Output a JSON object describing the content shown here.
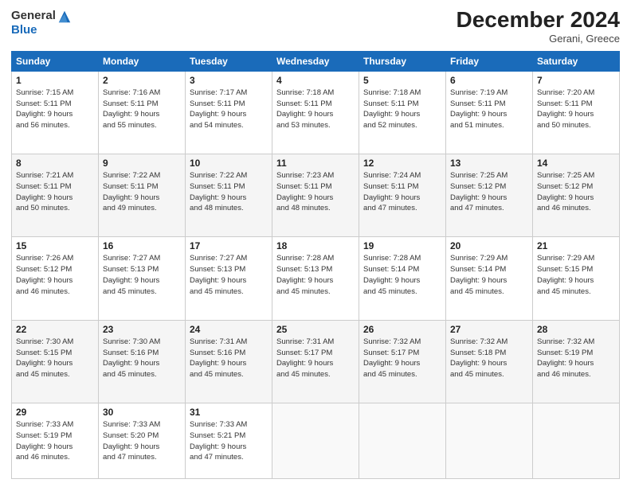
{
  "header": {
    "logo_general": "General",
    "logo_blue": "Blue",
    "month_title": "December 2024",
    "subtitle": "Gerani, Greece"
  },
  "weekdays": [
    "Sunday",
    "Monday",
    "Tuesday",
    "Wednesday",
    "Thursday",
    "Friday",
    "Saturday"
  ],
  "weeks": [
    [
      {
        "day": "1",
        "info": "Sunrise: 7:15 AM\nSunset: 5:11 PM\nDaylight: 9 hours\nand 56 minutes."
      },
      {
        "day": "2",
        "info": "Sunrise: 7:16 AM\nSunset: 5:11 PM\nDaylight: 9 hours\nand 55 minutes."
      },
      {
        "day": "3",
        "info": "Sunrise: 7:17 AM\nSunset: 5:11 PM\nDaylight: 9 hours\nand 54 minutes."
      },
      {
        "day": "4",
        "info": "Sunrise: 7:18 AM\nSunset: 5:11 PM\nDaylight: 9 hours\nand 53 minutes."
      },
      {
        "day": "5",
        "info": "Sunrise: 7:18 AM\nSunset: 5:11 PM\nDaylight: 9 hours\nand 52 minutes."
      },
      {
        "day": "6",
        "info": "Sunrise: 7:19 AM\nSunset: 5:11 PM\nDaylight: 9 hours\nand 51 minutes."
      },
      {
        "day": "7",
        "info": "Sunrise: 7:20 AM\nSunset: 5:11 PM\nDaylight: 9 hours\nand 50 minutes."
      }
    ],
    [
      {
        "day": "8",
        "info": "Sunrise: 7:21 AM\nSunset: 5:11 PM\nDaylight: 9 hours\nand 50 minutes."
      },
      {
        "day": "9",
        "info": "Sunrise: 7:22 AM\nSunset: 5:11 PM\nDaylight: 9 hours\nand 49 minutes."
      },
      {
        "day": "10",
        "info": "Sunrise: 7:22 AM\nSunset: 5:11 PM\nDaylight: 9 hours\nand 48 minutes."
      },
      {
        "day": "11",
        "info": "Sunrise: 7:23 AM\nSunset: 5:11 PM\nDaylight: 9 hours\nand 48 minutes."
      },
      {
        "day": "12",
        "info": "Sunrise: 7:24 AM\nSunset: 5:11 PM\nDaylight: 9 hours\nand 47 minutes."
      },
      {
        "day": "13",
        "info": "Sunrise: 7:25 AM\nSunset: 5:12 PM\nDaylight: 9 hours\nand 47 minutes."
      },
      {
        "day": "14",
        "info": "Sunrise: 7:25 AM\nSunset: 5:12 PM\nDaylight: 9 hours\nand 46 minutes."
      }
    ],
    [
      {
        "day": "15",
        "info": "Sunrise: 7:26 AM\nSunset: 5:12 PM\nDaylight: 9 hours\nand 46 minutes."
      },
      {
        "day": "16",
        "info": "Sunrise: 7:27 AM\nSunset: 5:13 PM\nDaylight: 9 hours\nand 45 minutes."
      },
      {
        "day": "17",
        "info": "Sunrise: 7:27 AM\nSunset: 5:13 PM\nDaylight: 9 hours\nand 45 minutes."
      },
      {
        "day": "18",
        "info": "Sunrise: 7:28 AM\nSunset: 5:13 PM\nDaylight: 9 hours\nand 45 minutes."
      },
      {
        "day": "19",
        "info": "Sunrise: 7:28 AM\nSunset: 5:14 PM\nDaylight: 9 hours\nand 45 minutes."
      },
      {
        "day": "20",
        "info": "Sunrise: 7:29 AM\nSunset: 5:14 PM\nDaylight: 9 hours\nand 45 minutes."
      },
      {
        "day": "21",
        "info": "Sunrise: 7:29 AM\nSunset: 5:15 PM\nDaylight: 9 hours\nand 45 minutes."
      }
    ],
    [
      {
        "day": "22",
        "info": "Sunrise: 7:30 AM\nSunset: 5:15 PM\nDaylight: 9 hours\nand 45 minutes."
      },
      {
        "day": "23",
        "info": "Sunrise: 7:30 AM\nSunset: 5:16 PM\nDaylight: 9 hours\nand 45 minutes."
      },
      {
        "day": "24",
        "info": "Sunrise: 7:31 AM\nSunset: 5:16 PM\nDaylight: 9 hours\nand 45 minutes."
      },
      {
        "day": "25",
        "info": "Sunrise: 7:31 AM\nSunset: 5:17 PM\nDaylight: 9 hours\nand 45 minutes."
      },
      {
        "day": "26",
        "info": "Sunrise: 7:32 AM\nSunset: 5:17 PM\nDaylight: 9 hours\nand 45 minutes."
      },
      {
        "day": "27",
        "info": "Sunrise: 7:32 AM\nSunset: 5:18 PM\nDaylight: 9 hours\nand 45 minutes."
      },
      {
        "day": "28",
        "info": "Sunrise: 7:32 AM\nSunset: 5:19 PM\nDaylight: 9 hours\nand 46 minutes."
      }
    ],
    [
      {
        "day": "29",
        "info": "Sunrise: 7:33 AM\nSunset: 5:19 PM\nDaylight: 9 hours\nand 46 minutes."
      },
      {
        "day": "30",
        "info": "Sunrise: 7:33 AM\nSunset: 5:20 PM\nDaylight: 9 hours\nand 47 minutes."
      },
      {
        "day": "31",
        "info": "Sunrise: 7:33 AM\nSunset: 5:21 PM\nDaylight: 9 hours\nand 47 minutes."
      },
      {
        "day": "",
        "info": ""
      },
      {
        "day": "",
        "info": ""
      },
      {
        "day": "",
        "info": ""
      },
      {
        "day": "",
        "info": ""
      }
    ]
  ]
}
